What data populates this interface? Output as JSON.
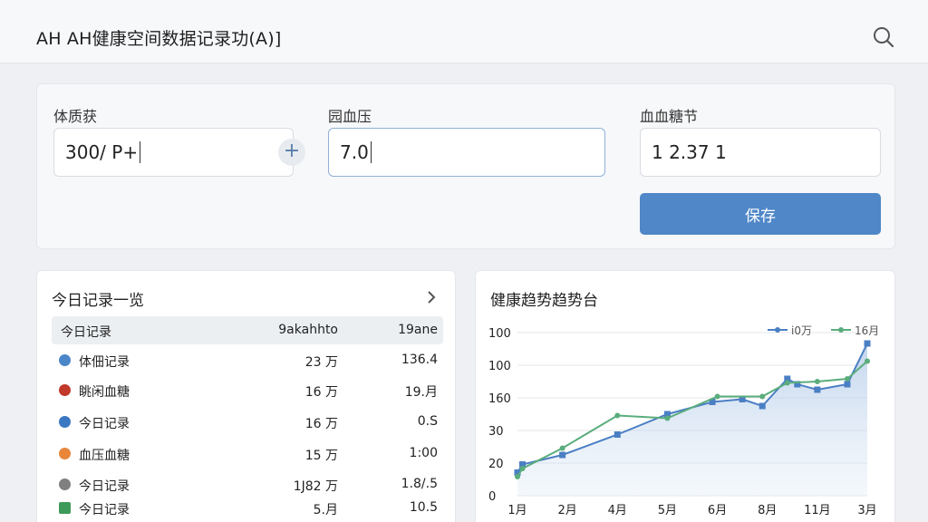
{
  "header": {
    "title": "AH AH健康空间数据记录功(A)]"
  },
  "form": {
    "field1": {
      "label": "体质获",
      "value": "300/ P+"
    },
    "field2": {
      "label": "园血压",
      "value": "7.0"
    },
    "field3": {
      "label": "血血糖节",
      "value": "1  2.37 1"
    },
    "plus_label": "+",
    "save_label": "保存"
  },
  "records": {
    "title": "今日记录一览",
    "columns": [
      "今日记录",
      "9akahhto",
      "19ane"
    ],
    "rows": [
      {
        "icon": "blue-dot-icon",
        "color": "#4a86c8",
        "name": "体佃记录",
        "c1": "23 万",
        "c2": "136.4"
      },
      {
        "icon": "red-apple-icon",
        "color": "#c0392b",
        "name": "眺闲血糖",
        "c1": "16 万",
        "c2": "19.月"
      },
      {
        "icon": "blue-drop-icon",
        "color": "#3a78c2",
        "name": "今日记录",
        "c1": "16 万",
        "c2": "0.S"
      },
      {
        "icon": "orange-flame-icon",
        "color": "#e8863a",
        "name": "血压血糖",
        "c1": "15 万",
        "c2": "1:00"
      },
      {
        "icon": "gray-circle-icon",
        "color": "#808080",
        "name": "今日记录",
        "c1": "1J82 万",
        "c2": "1.8/.5"
      },
      {
        "icon": "green-square-icon",
        "color": "#3e9a5a",
        "name": "今日记录",
        "c1": "5.月",
        "c2": "10.5"
      }
    ]
  },
  "chart_data": {
    "type": "line",
    "title": "健康趋势趋势台",
    "categories": [
      "1月",
      "2月",
      "4月",
      "5月",
      "6月",
      "8月",
      "11月",
      "3月"
    ],
    "y_ticks": [
      "100",
      "100",
      "160",
      "30",
      "20",
      "0"
    ],
    "ylim": [
      0,
      6
    ],
    "grid": true,
    "legend_position": "top-right",
    "series": [
      {
        "name": "i0万",
        "color": "#4a7fc4",
        "x": [
          0.0,
          0.1,
          0.9,
          2.0,
          3.0,
          3.9,
          4.5,
          4.9,
          5.4,
          5.6,
          6.0,
          6.6,
          7.0
        ],
        "values": [
          0.85,
          1.15,
          1.5,
          2.25,
          3.0,
          3.45,
          3.55,
          3.3,
          4.3,
          4.1,
          3.9,
          4.1,
          5.6
        ]
      },
      {
        "name": "16月",
        "color": "#5aad7c",
        "x": [
          0.0,
          0.1,
          0.9,
          2.0,
          3.0,
          4.0,
          4.9,
          5.4,
          6.0,
          6.6,
          7.0
        ],
        "values": [
          0.7,
          1.0,
          1.75,
          2.95,
          2.85,
          3.65,
          3.65,
          4.15,
          4.2,
          4.3,
          4.95
        ]
      }
    ]
  }
}
